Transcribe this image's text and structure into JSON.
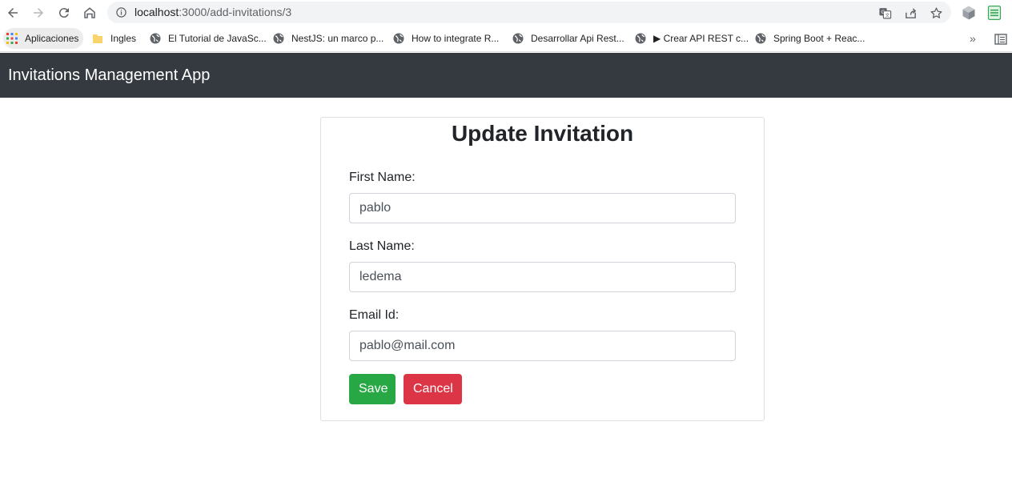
{
  "browser": {
    "url_host": "localhost",
    "url_rest": ":3000/add-invitations/3",
    "bookmarks": [
      {
        "label": "Aplicaciones",
        "icon": "apps-grid-icon"
      },
      {
        "label": "Ingles",
        "icon": "folder-icon"
      },
      {
        "label": "El Tutorial de JavaSc...",
        "icon": "globe-icon"
      },
      {
        "label": "NestJS: un marco p...",
        "icon": "globe-icon"
      },
      {
        "label": "How to integrate R...",
        "icon": "globe-icon"
      },
      {
        "label": "Desarrollar Api Rest...",
        "icon": "globe-icon"
      },
      {
        "label": "▶ Crear API REST c...",
        "icon": "globe-icon"
      },
      {
        "label": "Spring Boot + Reac...",
        "icon": "globe-icon"
      }
    ],
    "more_label": "»"
  },
  "header": {
    "brand": "Invitations Management App"
  },
  "form": {
    "title": "Update Invitation",
    "first_name": {
      "label": "First Name:",
      "value": "pablo"
    },
    "last_name": {
      "label": "Last Name:",
      "value": "ledema"
    },
    "email": {
      "label": "Email Id:",
      "value": "pablo@mail.com"
    },
    "save_label": "Save",
    "cancel_label": "Cancel"
  },
  "colors": {
    "header_bg": "#343a40",
    "save": "#28a745",
    "cancel": "#dc3545"
  }
}
